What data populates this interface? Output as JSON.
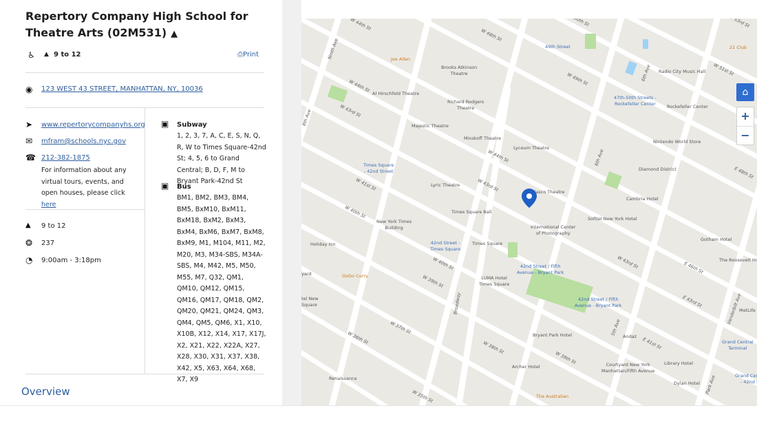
{
  "school": {
    "title": "Repertory Company High School for Theatre Arts (02M531)",
    "grade_short": "9 to 12",
    "print_label": "Print",
    "address": "123 WEST 43 STREET, MANHATTAN, NY, 10036",
    "website": "www.repertorycompanyhs.org",
    "email": "mfram@schools.nyc.gov",
    "phone": "212-382-1875",
    "info_text": "For information about any virtual tours, events, and open houses, please click",
    "info_link": "here",
    "grades": "9 to 12",
    "enrollment": "237",
    "hours": "9:00am - 3:18pm",
    "subway_heading": "Subway",
    "subway_text": "1, 2, 3, 7, A, C, E, S, N, Q, R, W to Times Square-42nd St; 4, 5, 6 to Grand Central; B, D, F, M to Bryant Park-42nd St",
    "bus_heading": "Bus",
    "bus_text": "BM1, BM2, BM3, BM4, BM5, BxM10, BxM11, BxM18, BxM2, BxM3, BxM4, BxM6, BxM7, BxM8, BxM9, M1, M104, M11, M2, M20, M3, M34-SBS, M34A-SBS, M4, M42, M5, M50, M55, M7, Q32, QM1, QM10, QM12, QM15, QM16, QM17, QM18, QM2, QM20, QM21, QM24, QM3, QM4, QM5, QM6, X1, X10, X10B, X12, X14, X17, X17J, X2, X21, X22, X22A, X27, X28, X30, X31, X37, X38, X42, X5, X63, X64, X68, X7, X9",
    "overview_label": "Overview"
  },
  "icons": {
    "accessible": "wheelchair-icon",
    "grad_cap": "graduation-cap-icon",
    "printer": "printer-icon",
    "location": "map-pin-icon",
    "website": "navigation-arrow-icon",
    "email": "envelope-icon",
    "phone": "phone-icon",
    "subway": "train-icon",
    "bus": "bus-icon",
    "enrollment": "people-icon",
    "clock": "clock-icon"
  },
  "map": {
    "zoom_in": "+",
    "zoom_out": "−",
    "pin_color": "#1f5fc4",
    "labels": {
      "streets": [
        "W 44th St",
        "W 48th St",
        "50th St",
        "W 43rd St",
        "W 42nd St",
        "W 41st St",
        "W 40th St",
        "W 39th St",
        "W 38th St",
        "W 37th St",
        "W 36th St",
        "W 35th St",
        "W 49th St",
        "W 51st St",
        "E 48th St",
        "E 46th St",
        "E 43rd St",
        "E 41st St",
        "Ninth Ave",
        "6th Ave",
        "Broadway",
        "Park Ave",
        "Vanderbilt Ave",
        "8th Ave",
        "5th Ave",
        "W 53rd St"
      ],
      "poi": [
        "Joe Allen",
        "Brooks Atkinson Theatre",
        "Al Hirschfeld Theatre",
        "Richard Rodgers Theatre",
        "Majestic Theatre",
        "Minskoff Theatre",
        "Lyceum Theatre",
        "Times Square - 42nd Street",
        "Lyric Theatre",
        "Belasco Theatre",
        "Times Square Ball",
        "New York Times Building",
        "International Center of Photography",
        "Sofitel New York Hotel",
        "42nd Street - Times Square",
        "Times Square",
        "Holiday Inn",
        "GoGo Curry",
        "LUMA Hotel Times Square",
        "42nd Street / Fifth Avenue - Bryant Park",
        "Bryant Park Hotel",
        "Andaz",
        "Archer Hotel",
        "Courtyard New York Manhattan/Fifth Avenue",
        "Library Hotel",
        "Dylan Hotel",
        "Renaissance",
        "The Australian",
        "49th Street",
        "Radio City Music Hall",
        "47th-50th Streets - Rockefeller Center",
        "Rockefeller Center",
        "Nintendo World Store",
        "Diamond District",
        "Cambria Hotel",
        "Gotham Hotel",
        "The Roosevelt Hotel",
        "Grand Central Terminal",
        "Grand Central - 42nd St",
        "MetLife",
        "21 Club",
        "yard",
        "tel New Square"
      ]
    }
  }
}
